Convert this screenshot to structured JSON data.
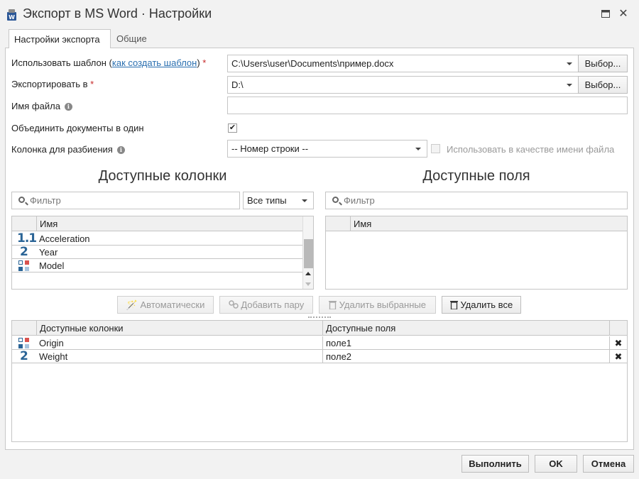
{
  "window": {
    "title": "Экспорт в MS Word · Настройки",
    "icon": "word-export-icon",
    "maximize_glyph": "🗖",
    "close_glyph": "✕"
  },
  "tabs": [
    {
      "label": "Настройки экспорта",
      "active": true
    },
    {
      "label": "Общие",
      "active": false
    }
  ],
  "form": {
    "template": {
      "label_prefix": "Использовать шаблон (",
      "link_text": "как создать шаблон",
      "label_suffix": ")",
      "required_mark": "*",
      "value": "C:\\Users\\user\\Documents\\пример.docx",
      "browse_label": "Выбор..."
    },
    "export_to": {
      "label": "Экспортировать в",
      "required_mark": "*",
      "value": "D:\\",
      "browse_label": "Выбор..."
    },
    "file_name": {
      "label": "Имя файла",
      "info_glyph": "i",
      "value": ""
    },
    "merge_docs": {
      "label": "Объединить документы в один",
      "checked": true,
      "check_glyph": "✔"
    },
    "split_column": {
      "label": "Колонка для разбиения",
      "info_glyph": "i",
      "value": "-- Номер строки --",
      "use_as_filename_label": "Использовать в качестве имени файла",
      "use_as_filename_checked": false
    }
  },
  "available_columns": {
    "title": "Доступные колонки",
    "filter_placeholder": "Фильтр",
    "type_filter": "Все типы",
    "header_name": "Имя",
    "rows": [
      {
        "icon": "decimal-number-icon",
        "icon_text": "1.1",
        "name": "Acceleration"
      },
      {
        "icon": "integer-number-icon",
        "icon_text": "2",
        "name": "Year"
      },
      {
        "icon": "category-icon",
        "icon_text": "",
        "name": "Model"
      }
    ]
  },
  "available_fields": {
    "title": "Доступные поля",
    "filter_placeholder": "Фильтр",
    "header_name": "Имя"
  },
  "actions": {
    "auto": "Автоматически",
    "add_pair": "Добавить пару",
    "remove_selected": "Удалить выбранные",
    "remove_all": "Удалить все"
  },
  "mapping": {
    "header_columns": "Доступные колонки",
    "header_fields": "Доступные поля",
    "remove_glyph": "✖",
    "rows": [
      {
        "icon": "category-icon",
        "icon_text": "",
        "column": "Origin",
        "field": "поле1"
      },
      {
        "icon": "integer-number-icon",
        "icon_text": "2",
        "column": "Weight",
        "field": "поле2"
      }
    ]
  },
  "footer": {
    "run": "Выполнить",
    "ok": "OK",
    "cancel": "Отмена"
  },
  "colors": {
    "accent_blue": "#2a6496",
    "required_red": "#c62828",
    "link": "#2a6fb0"
  }
}
